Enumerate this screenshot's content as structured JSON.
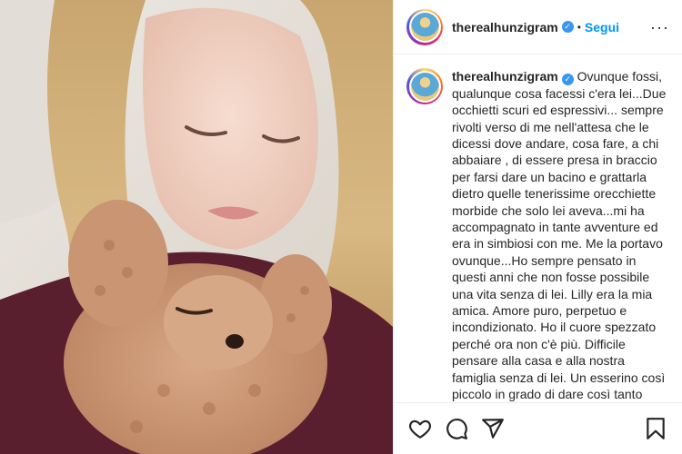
{
  "post": {
    "username": "therealhunzigram",
    "verified_icon": "verified-check-icon",
    "separator": "•",
    "follow_label": "Segui",
    "more_icon": "more-options-icon",
    "more_glyph": "···",
    "caption": "Ovunque fossi, qualunque cosa facessi c'era lei...Due occhietti scuri ed espressivi... sempre rivolti verso di me nell'attesa che le dicessi dove andare, cosa fare, a chi abbaiare , di essere presa in braccio per farsi dare un bacino e grattarla dietro quelle tenerissime orecchiette morbide che solo lei aveva...mi ha accompagnato in tante avventure ed era in simbiosi con me. Me la portavo ovunque...Ho sempre pensato in questi anni che non fosse possibile una vita senza di lei. Lilly era la mia amica. Amore puro, perpetuo e incondizionato. Ho il cuore spezzato perché ora non c'è più. Difficile pensare alla casa e alla nostra famiglia senza di lei. Un esserino così piccolo in grado di dare così tanto amore. Q"
  },
  "actions": {
    "like_icon": "heart-icon",
    "comment_icon": "comment-icon",
    "share_icon": "send-icon",
    "save_icon": "bookmark-icon"
  },
  "colors": {
    "follow": "#0095f6",
    "verified": "#3897f0",
    "text": "#262626",
    "border": "#efefef"
  }
}
